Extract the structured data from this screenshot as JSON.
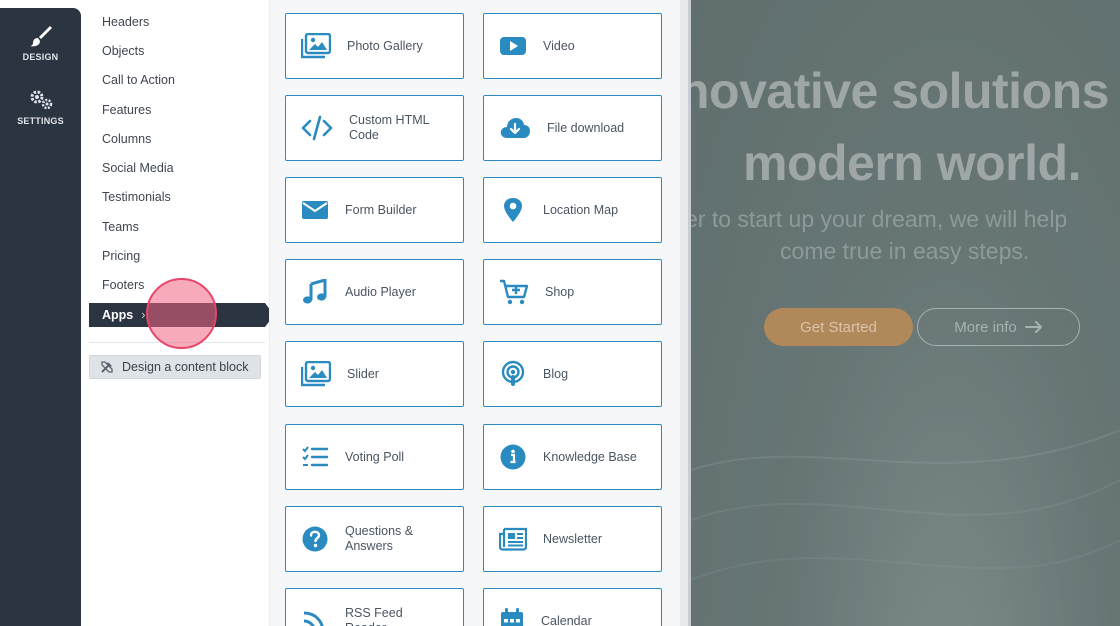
{
  "rail": {
    "design_label": "DESIGN",
    "settings_label": "SETTINGS"
  },
  "categories": {
    "items": [
      "Headers",
      "Objects",
      "Call to Action",
      "Features",
      "Columns",
      "Social Media",
      "Testimonials",
      "Teams",
      "Pricing",
      "Footers"
    ],
    "active": "Apps",
    "design_button": "Design a content block"
  },
  "apps": [
    {
      "label": "Photo Gallery",
      "icon": "photo-gallery-icon"
    },
    {
      "label": "Video",
      "icon": "video-icon"
    },
    {
      "label": "Custom HTML Code",
      "icon": "code-icon"
    },
    {
      "label": "File download",
      "icon": "cloud-download-icon"
    },
    {
      "label": "Form Builder",
      "icon": "envelope-icon"
    },
    {
      "label": "Location Map",
      "icon": "map-pin-icon"
    },
    {
      "label": "Audio Player",
      "icon": "music-note-icon"
    },
    {
      "label": "Shop",
      "icon": "cart-icon"
    },
    {
      "label": "Slider",
      "icon": "slider-image-icon"
    },
    {
      "label": "Blog",
      "icon": "podcast-icon"
    },
    {
      "label": "Voting Poll",
      "icon": "checklist-icon"
    },
    {
      "label": "Knowledge Base",
      "icon": "info-icon"
    },
    {
      "label": "Questions & Answers",
      "icon": "question-icon"
    },
    {
      "label": "Newsletter",
      "icon": "newspaper-icon"
    },
    {
      "label": "RSS Feed Reader",
      "icon": "rss-icon"
    },
    {
      "label": "Calendar",
      "icon": "calendar-icon"
    }
  ],
  "preview": {
    "headline_1": "novative solutions",
    "headline_2": "modern world.",
    "subline_1": "er to start up your dream, we will help",
    "subline_2": "come true in easy steps.",
    "get_started": "Get Started",
    "more_info": "More info"
  },
  "colors": {
    "accent": "#2a8bc1",
    "rail": "#2b3441",
    "click_indicator": "#e8456a"
  }
}
